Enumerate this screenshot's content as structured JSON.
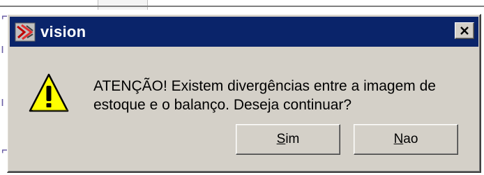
{
  "dialog": {
    "title": "vision",
    "app_icon": "vision-app-icon",
    "close_icon": "close-icon",
    "warning_icon": "warning-exclamation-icon",
    "message_line1": "ATENÇÃO! Existem divergências entre a imagem de",
    "message_line2": "estoque e o balanço. Deseja continuar?",
    "buttons": {
      "yes": {
        "mnemonic": "S",
        "rest": "im"
      },
      "no": {
        "mnemonic": "N",
        "rest": "ao"
      }
    }
  },
  "colors": {
    "titlebar": "#0a246a",
    "dialog_face": "#d4d0c8",
    "warning_fill": "#ffff00"
  }
}
